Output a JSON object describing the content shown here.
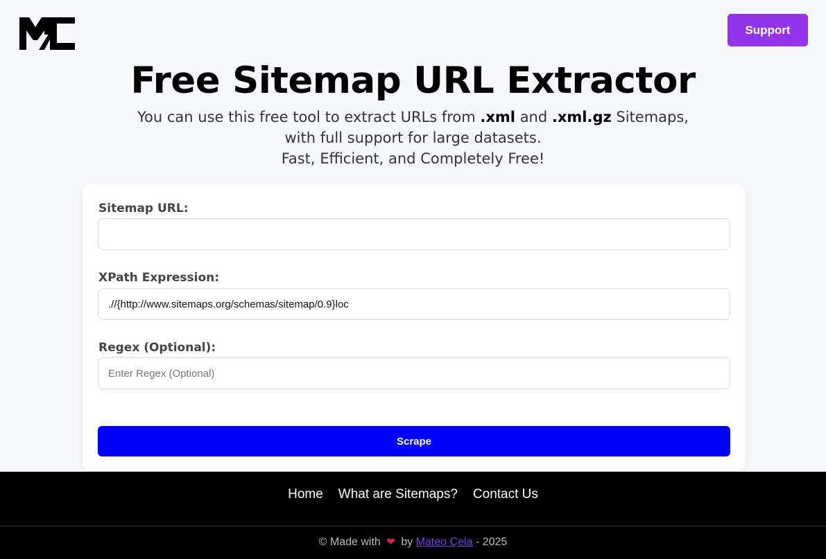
{
  "header": {
    "logo_text": "MC",
    "support_label": "Support"
  },
  "hero": {
    "title": "Free Sitemap URL Extractor",
    "line1_pre": "You can use this free tool to extract URLs from ",
    "ext1": ".xml",
    "line1_mid": " and ",
    "ext2": ".xml.gz",
    "line1_post": " Sitemaps,",
    "line2": "with full support for large datasets.",
    "line3": "Fast, Efficient, and Completely Free!"
  },
  "form": {
    "sitemap_label": "Sitemap URL:",
    "sitemap_value": "",
    "xpath_label": "XPath Expression:",
    "xpath_value": ".//{http://www.sitemaps.org/schemas/sitemap/0.9}loc",
    "regex_label": "Regex (Optional):",
    "regex_placeholder": "Enter Regex (Optional)",
    "scrape_label": "Scrape"
  },
  "footer": {
    "nav": [
      "Home",
      "What are Sitemaps?",
      "Contact Us"
    ],
    "copy_pre": "© Made with",
    "heart_icon": "heart-icon",
    "copy_by": "by",
    "author": "Mateo Çela",
    "copy_year": "- 2025"
  },
  "colors": {
    "support": "#9333ea",
    "scrape": "#0000ff",
    "author_link": "#7c3aed",
    "heart": "#e11d48"
  }
}
